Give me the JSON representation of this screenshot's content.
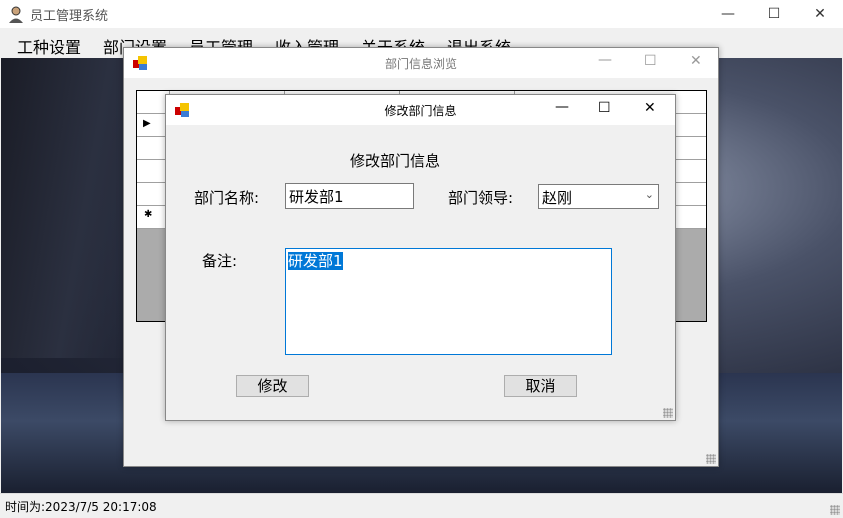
{
  "app": {
    "title": "员工管理系统",
    "icon": "user-avatar-icon"
  },
  "menu": [
    "工种设置",
    "部门设置",
    "员工管理",
    "收入管理",
    "关于系统",
    "退出系统"
  ],
  "browse_window": {
    "title": "部门信息浏览"
  },
  "edit_dialog": {
    "title": "修改部门信息",
    "heading": "修改部门信息",
    "name_label": "部门名称:",
    "name_value": "研发部1",
    "leader_label": "部门领导:",
    "leader_value": "赵刚",
    "note_label": "备注:",
    "note_value": "研发部1",
    "ok_button": "修改",
    "cancel_button": "取消"
  },
  "status": {
    "text": "时间为:2023/7/5 20:17:08"
  },
  "colors": {
    "selection": "#0078d7",
    "focus_border": "#0078d7"
  }
}
